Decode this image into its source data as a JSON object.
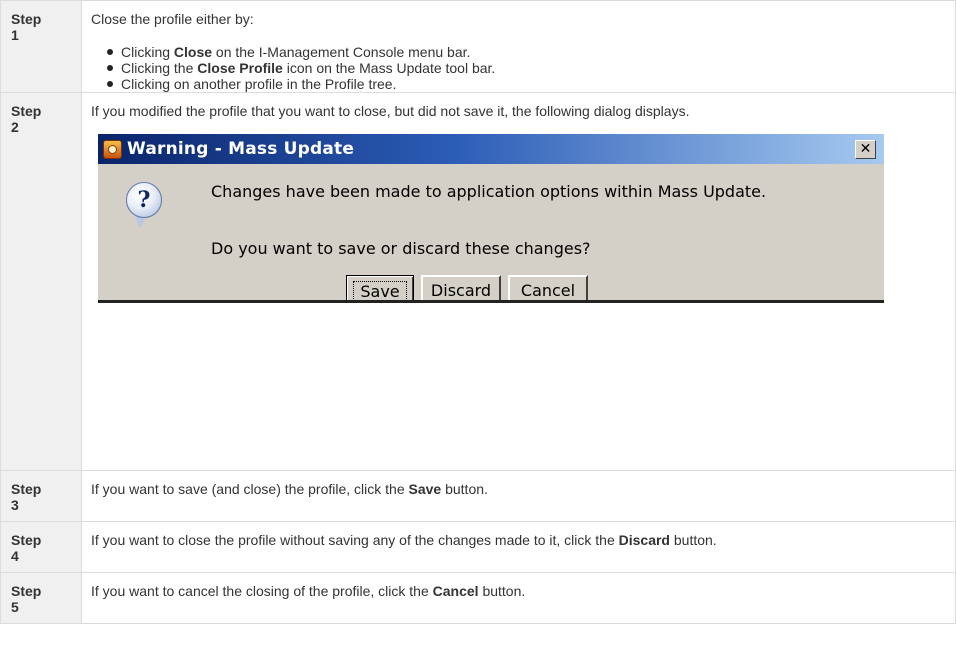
{
  "steps": [
    {
      "label": "Step",
      "num": "1",
      "intro": "Close the profile either by:",
      "bullets": [
        {
          "pre": "Clicking ",
          "bold": "Close",
          "post": " on the I-Management Console menu bar."
        },
        {
          "pre": "Clicking the ",
          "bold": "Close Profile",
          "post": " icon on the Mass Update tool bar."
        },
        {
          "pre": "Clicking on another profile in the Profile tree.",
          "bold": "",
          "post": ""
        }
      ]
    },
    {
      "label": "Step",
      "num": "2",
      "text": "If you modified the profile that you want to close, but did not save it, the following dialog displays."
    },
    {
      "label": "Step",
      "num": "3",
      "pre": "If you want to save (and close) the profile, click the ",
      "bold": "Save",
      "post": " button."
    },
    {
      "label": "Step",
      "num": "4",
      "pre": "If you want to close the profile without saving any of the changes made to it, click the ",
      "bold": "Discard",
      "post": " button."
    },
    {
      "label": "Step",
      "num": "5",
      "pre": "If you want to cancel the closing of the profile, click the ",
      "bold": "Cancel",
      "post": " button."
    }
  ],
  "dialog": {
    "title": "Warning - Mass Update",
    "close_glyph": "✕",
    "question_mark": "?",
    "message": "Changes have been made to application options within Mass Update.",
    "prompt": "Do you want to save or discard these changes?",
    "buttons": {
      "save": "Save",
      "discard": "Discard",
      "cancel": "Cancel"
    },
    "title_gradient": [
      "#0a246a",
      "#a6caf0"
    ],
    "face_color": "#d4d0c8"
  },
  "icons": {
    "app": "mass-update-app-icon",
    "question": "question-balloon-icon",
    "close": "close-icon"
  }
}
